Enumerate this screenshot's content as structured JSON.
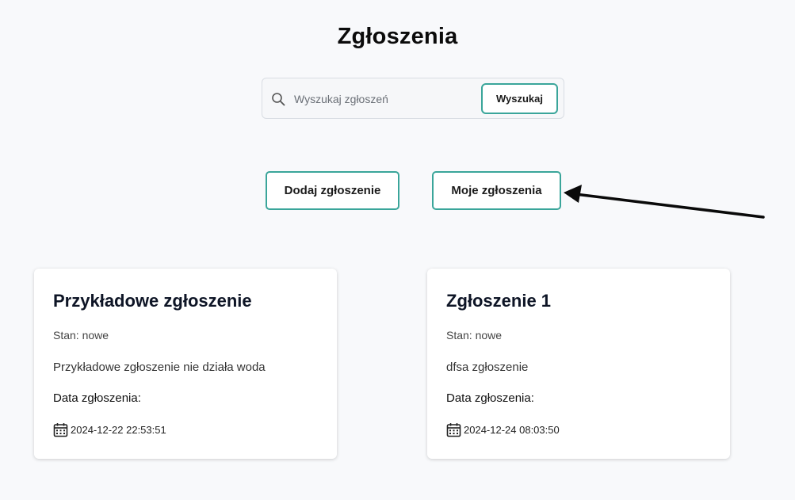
{
  "page": {
    "title": "Zgłoszenia"
  },
  "search": {
    "icon": "search-icon",
    "placeholder": "Wyszukaj zgłoszeń",
    "value": "",
    "button_label": "Wyszukaj"
  },
  "actions": {
    "add_label": "Dodaj zgłoszenie",
    "mine_label": "Moje zgłoszenia"
  },
  "cards": [
    {
      "title": "Przykładowe zgłoszenie",
      "status": "Stan: nowe",
      "description": "Przykładowe zgłoszenie nie działa woda",
      "date_label": "Data zgłoszenia:",
      "date_icon": "calendar-icon",
      "date": "2024-12-22 22:53:51"
    },
    {
      "title": "Zgłoszenie 1",
      "status": "Stan: nowe",
      "description": "dfsa zgłoszenie",
      "date_label": "Data zgłoszenia:",
      "date_icon": "calendar-icon",
      "date": "2024-12-24 08:03:50"
    }
  ],
  "colors": {
    "accent": "#3aa59a",
    "background": "#f8f9fb",
    "card": "#ffffff"
  }
}
